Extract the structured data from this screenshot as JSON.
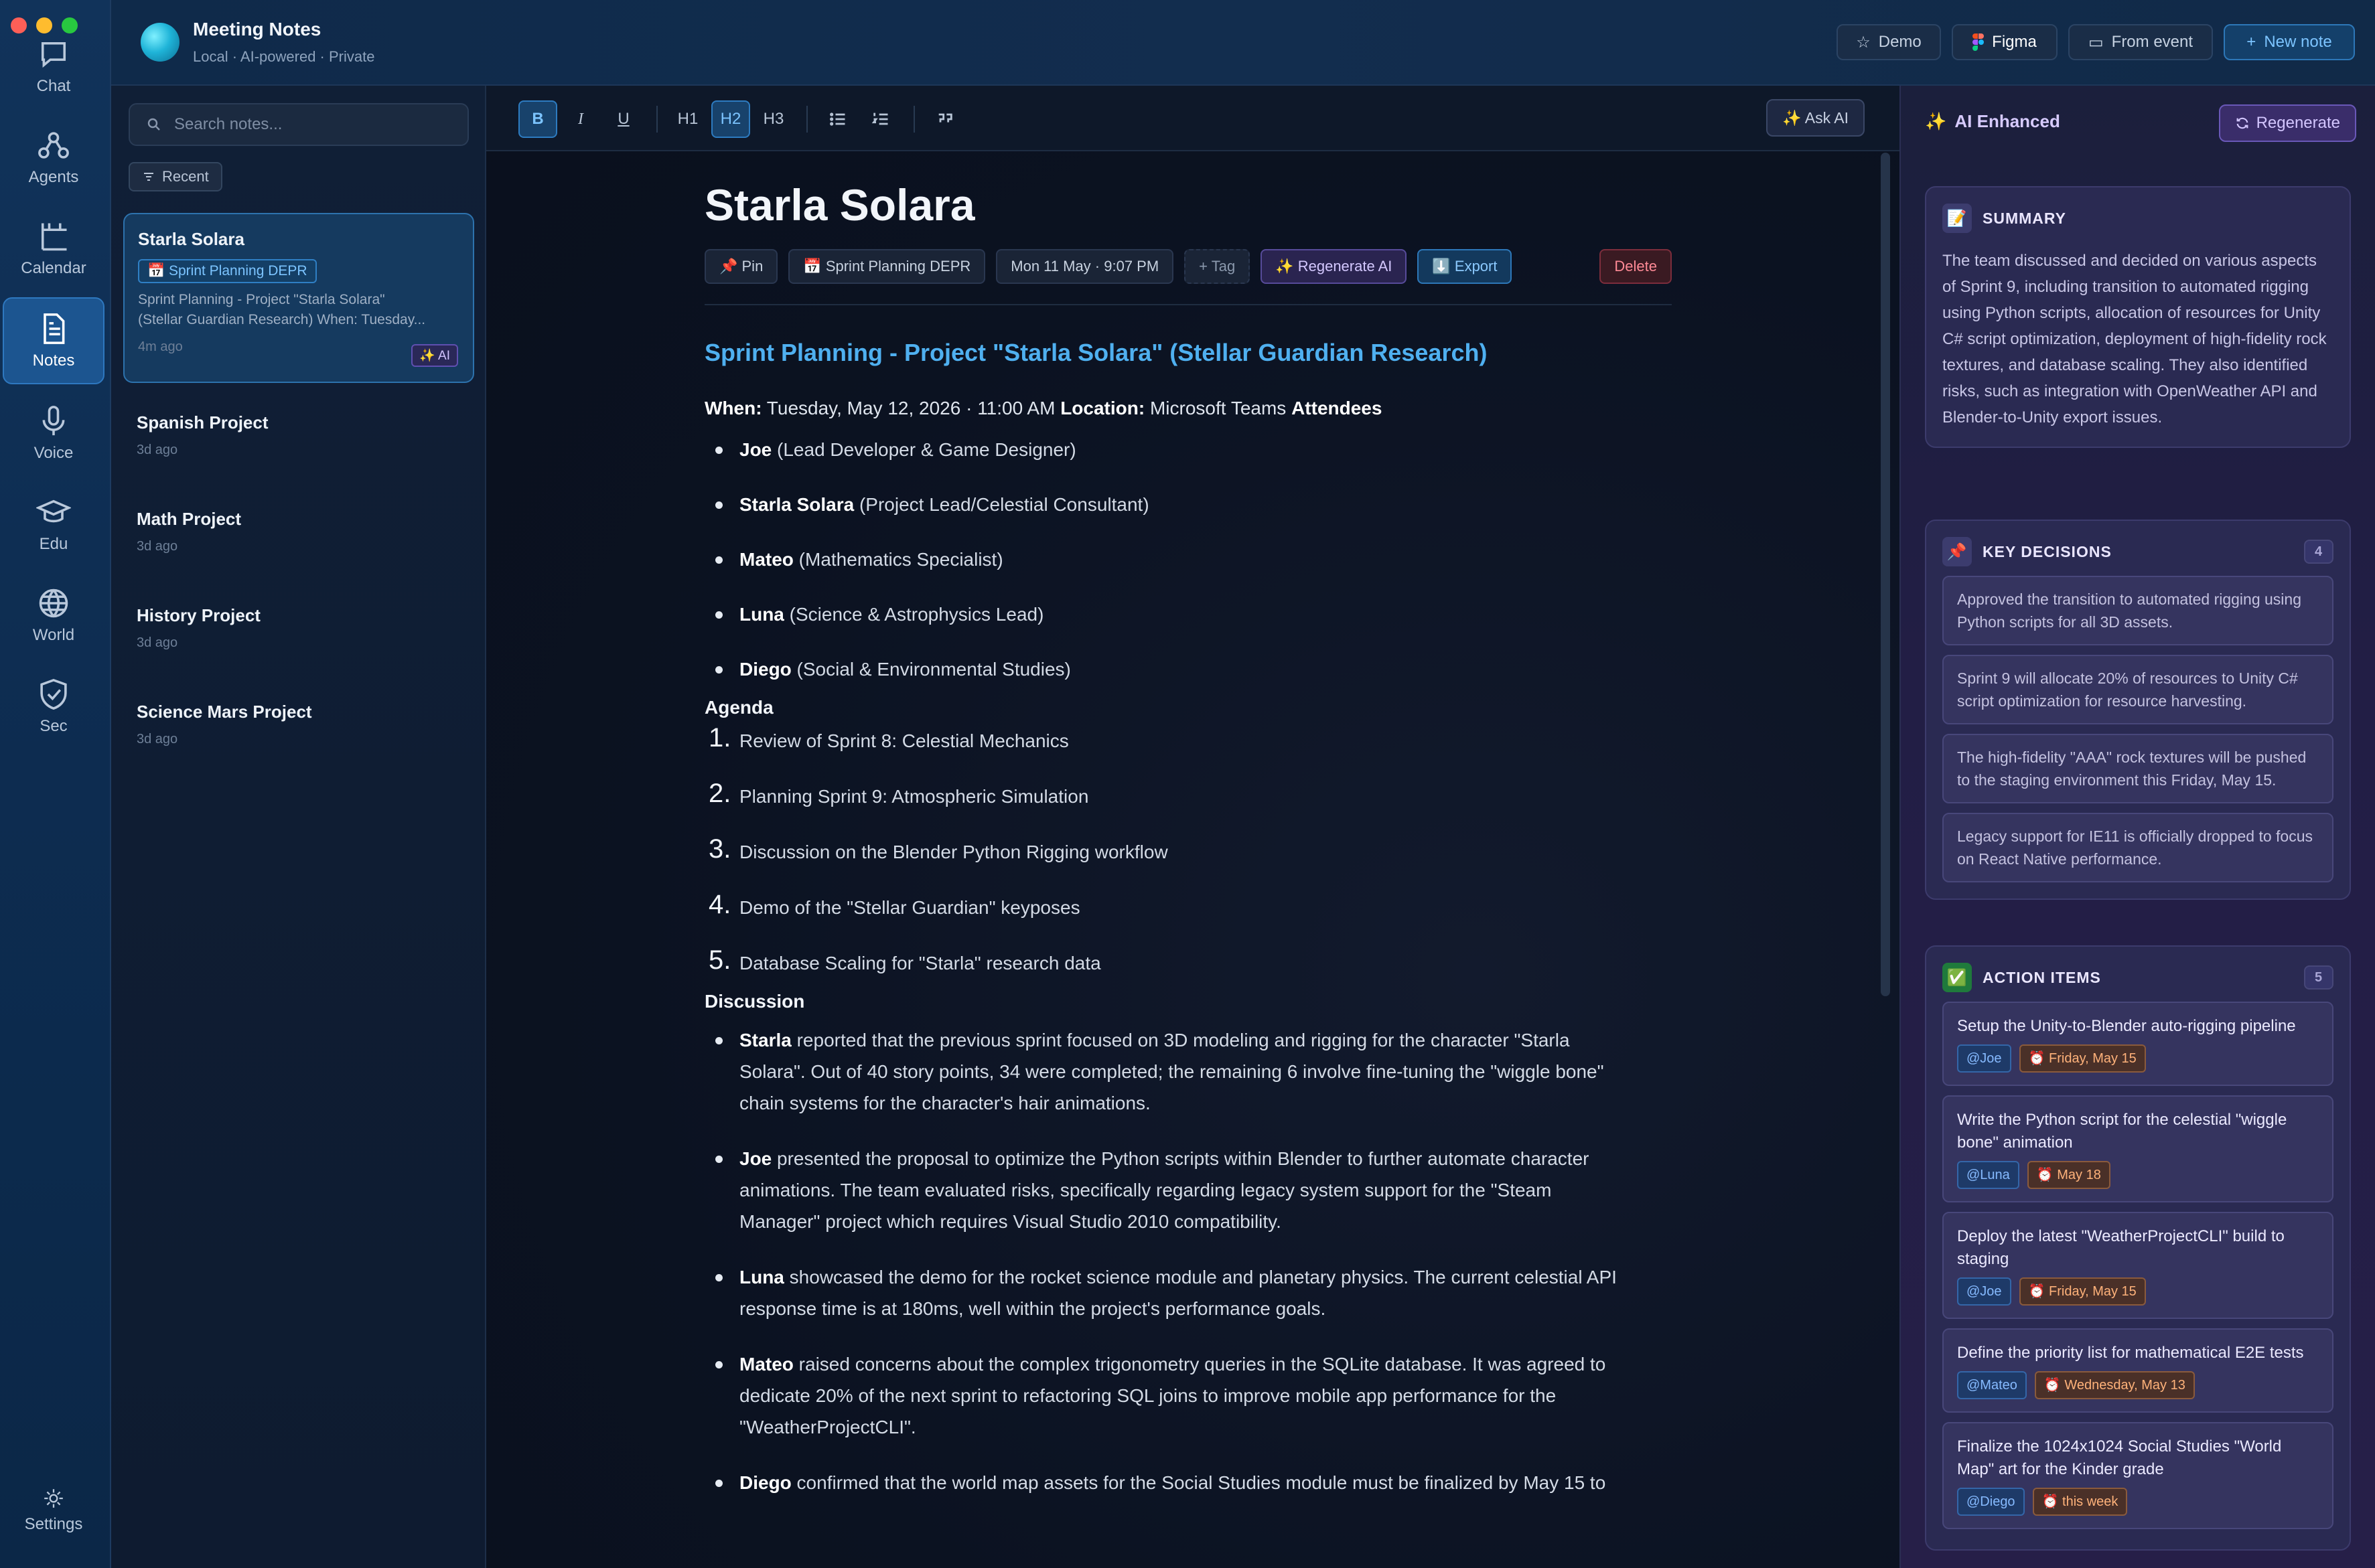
{
  "rail": {
    "items": [
      {
        "label": "Chat"
      },
      {
        "label": "Agents"
      },
      {
        "label": "Calendar"
      },
      {
        "label": "Notes"
      },
      {
        "label": "Voice"
      },
      {
        "label": "Edu"
      },
      {
        "label": "World"
      },
      {
        "label": "Sec"
      }
    ],
    "settings_label": "Settings"
  },
  "header": {
    "title": "Meeting Notes",
    "subtitle": "Local · AI-powered · Private",
    "buttons": {
      "demo": "Demo",
      "figma": "Figma",
      "from_event": "From event",
      "new_note": "New note"
    }
  },
  "sidebar": {
    "search_placeholder": "Search notes...",
    "filter_label": "Recent",
    "notes": [
      {
        "title": "Starla Solara",
        "tag": "📅 Sprint Planning DEPR",
        "preview_1": "Sprint Planning - Project \"Starla Solara\"",
        "preview_2": "(Stellar Guardian Research) When: Tuesday...",
        "time": "4m ago",
        "badge": "✨ AI"
      },
      {
        "title": "Spanish Project",
        "time": "3d ago"
      },
      {
        "title": "Math Project",
        "time": "3d ago"
      },
      {
        "title": "History Project",
        "time": "3d ago"
      },
      {
        "title": "Science Mars Project",
        "time": "3d ago"
      }
    ]
  },
  "toolbar": {
    "bold": "B",
    "italic": "I",
    "underline": "U",
    "h1": "H1",
    "h2": "H2",
    "h3": "H3",
    "ask_ai": "✨ Ask AI"
  },
  "doc": {
    "title": "Starla Solara",
    "meta": {
      "pin": "📌 Pin",
      "template": "📅 Sprint Planning DEPR",
      "date": "Mon 11 May · 9:07 PM",
      "tag": "+ Tag",
      "regenerate": "✨ Regenerate AI",
      "export": "⬇️ Export",
      "delete": "Delete"
    },
    "heading": "Sprint Planning - Project \"Starla Solara\" (Stellar Guardian Research)",
    "when_label": "When:",
    "when_value": " Tuesday, May 12, 2026 · 11:00 AM ",
    "location_label": "Location:",
    "location_value": " Microsoft Teams ",
    "attendees_label": "Attendees",
    "attendees": [
      {
        "name": "Joe",
        "role": " (Lead Developer & Game Designer)"
      },
      {
        "name": "Starla Solara",
        "role": " (Project Lead/Celestial Consultant)"
      },
      {
        "name": "Mateo",
        "role": " (Mathematics Specialist)"
      },
      {
        "name": "Luna",
        "role": " (Science & Astrophysics Lead)"
      },
      {
        "name": "Diego",
        "role": " (Social & Environmental Studies)"
      }
    ],
    "agenda_label": "Agenda",
    "agenda": [
      {
        "n": "1.",
        "text": "Review of Sprint 8: Celestial Mechanics"
      },
      {
        "n": "2.",
        "text": "Planning Sprint 9: Atmospheric Simulation"
      },
      {
        "n": "3.",
        "text": "Discussion on the Blender Python Rigging workflow"
      },
      {
        "n": "4.",
        "text": "Demo of the \"Stellar Guardian\" keyposes"
      },
      {
        "n": "5.",
        "text": "Database Scaling for \"Starla\" research data"
      }
    ],
    "discussion_label": "Discussion",
    "discussion": [
      {
        "name": "Starla",
        "line1": " reported that the previous sprint focused on 3D modeling and rigging for the character \"Starla",
        "line2": "Solara\". Out of 40 story points, 34 were completed; the remaining 6 involve fine-tuning the \"wiggle bone\"",
        "line3": "chain systems for the character's hair animations."
      },
      {
        "name": "Joe",
        "line1": " presented the proposal to optimize the Python scripts within Blender to further automate character",
        "line2": "animations. The team evaluated risks, specifically regarding legacy system support for the \"Steam",
        "line3": "Manager\" project which requires Visual Studio 2010 compatibility."
      },
      {
        "name": "Luna",
        "line1": " showcased the demo for the rocket science module and planetary physics. The current celestial API",
        "line2": "response time is at 180ms, well within the project's performance goals.",
        "line3": ""
      },
      {
        "name": "Mateo",
        "line1": " raised concerns about the complex trigonometry queries in the SQLite database. It was agreed to",
        "line2": "dedicate 20% of the next sprint to refactoring SQL joins to improve mobile app performance for the",
        "line3": "\"WeatherProjectCLI\"."
      },
      {
        "name": "Diego",
        "line1": " confirmed that the world map assets for the Social Studies module must be finalized by May 15 to",
        "line2": "",
        "line3": ""
      }
    ]
  },
  "ai_panel": {
    "title": "AI Enhanced",
    "regenerate": "Regenerate",
    "summary_title": "SUMMARY",
    "summary": "The team discussed and decided on various aspects of Sprint 9, including transition to automated rigging using Python scripts, allocation of resources for Unity C# script optimization, deployment of high-fidelity rock textures, and database scaling. They also identified risks, such as integration with OpenWeather API and Blender-to-Unity export issues.",
    "decisions_title": "KEY DECISIONS",
    "decisions_count": "4",
    "decisions": [
      "Approved the transition to automated rigging using Python scripts for all 3D assets.",
      "Sprint 9 will allocate 20% of resources to Unity C# script optimization for resource harvesting.",
      "The high-fidelity \"AAA\" rock textures will be pushed to the staging environment this Friday, May 15.",
      "Legacy support for IE11 is officially dropped to focus on React Native performance."
    ],
    "actions_title": "ACTION ITEMS",
    "actions_count": "5",
    "actions": [
      {
        "text": "Setup the Unity-to-Blender auto-rigging pipeline",
        "who": "@Joe",
        "when": "⏰ Friday, May 15"
      },
      {
        "text": "Write the Python script for the celestial \"wiggle bone\" animation",
        "who": "@Luna",
        "when": "⏰ May 18"
      },
      {
        "text": "Deploy the latest \"WeatherProjectCLI\" build to staging",
        "who": "@Joe",
        "when": "⏰ Friday, May 15"
      },
      {
        "text": "Define the priority list for mathematical E2E tests",
        "who": "@Mateo",
        "when": "⏰ Wednesday, May 13"
      },
      {
        "text": "Finalize the 1024x1024 Social Studies \"World Map\" art for the Kinder grade",
        "who": "@Diego",
        "when": "⏰ this week"
      }
    ]
  },
  "colors": {
    "accent": "#4fb0f0",
    "ai_purple": "#d7cbff",
    "danger": "#ff8a96"
  }
}
